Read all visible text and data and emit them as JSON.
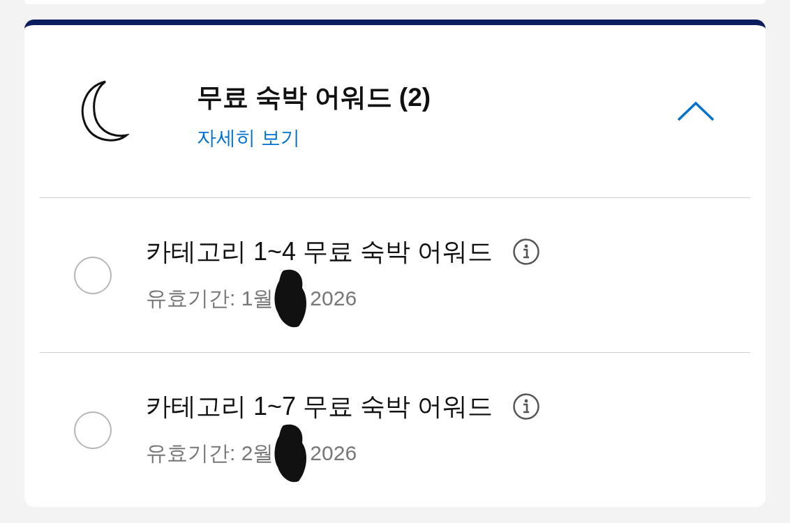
{
  "section": {
    "title": "무료 숙박 어워드 (2)",
    "link": "자세히 보기",
    "expanded": true,
    "awards": [
      {
        "title": "카테고리 1~4 무료 숙박 어워드",
        "validity_start": "유효기간: 1월",
        "validity_end": "2026",
        "selected": false
      },
      {
        "title": "카테고리 1~7 무료 숙박 어워드",
        "validity_start": "유효기간: 2월",
        "validity_end": "2026",
        "selected": false
      }
    ]
  }
}
